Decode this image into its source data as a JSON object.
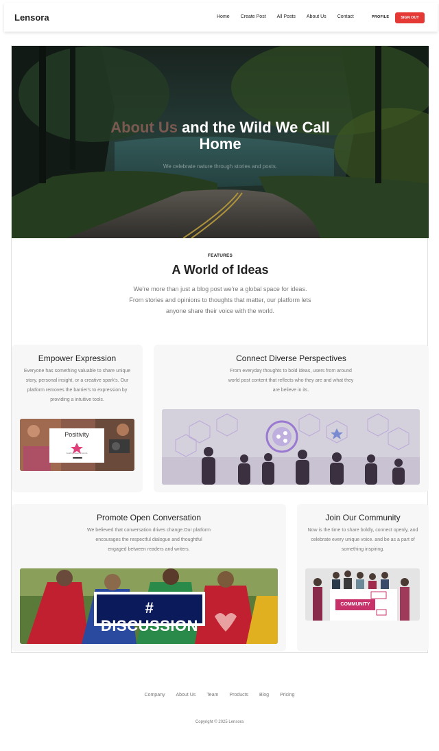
{
  "nav": {
    "brand": "Lensora",
    "links": [
      "Home",
      "Create Post",
      "All Posts",
      "About Us",
      "Contact"
    ],
    "profile": "PROFILE",
    "signout": "SIGN OUT"
  },
  "hero": {
    "title_highlight": "About Us",
    "title_rest_line1": " and the Wild We Call",
    "title_line2": "Home",
    "subtitle": "We celebrate nature through stories and posts."
  },
  "features": {
    "kicker": "FEATURES",
    "title": "A World of Ideas",
    "description": "We're more than just a blog post we're a global space for ideas. From stories and opinions to thoughts that matter, our platform lets anyone share their voice with the world."
  },
  "cards": [
    {
      "title": "Empower Expression",
      "description": "Everyone has something valuable to share unique story, personal insight, or a creative spark's. Our platform removes the barrier's to expression by providing a intuitive tools.",
      "image_text": "Positivity",
      "image_caption": "healthy powerful words"
    },
    {
      "title": "Connect Diverse Perspectives",
      "description": "From everyday thoughts to bold ideas, users from around world post content that reflects who they are and what they are believe in its."
    },
    {
      "title": "Promote Open Conversation",
      "description": "We believed that conversation drives change.Our platform encourages the respectful dialogue and thoughtful engaged between readers and writers.",
      "image_text": "# DISCUSSION"
    },
    {
      "title": "Join Our Community",
      "description": "Now is the time to share boldly, connect openly, and celebrate every unique voice. and be as a part of something inspiring.",
      "image_text": "COMMUNITY"
    }
  ],
  "footer": {
    "links": [
      "Company",
      "About Us",
      "Team",
      "Products",
      "Blog",
      "Pricing"
    ],
    "copyright": "Copyright © 2025 Lensora"
  },
  "colors": {
    "accent": "#e53935",
    "hero_highlight": "#7a5a50",
    "card_bg": "#f7f7f7"
  }
}
